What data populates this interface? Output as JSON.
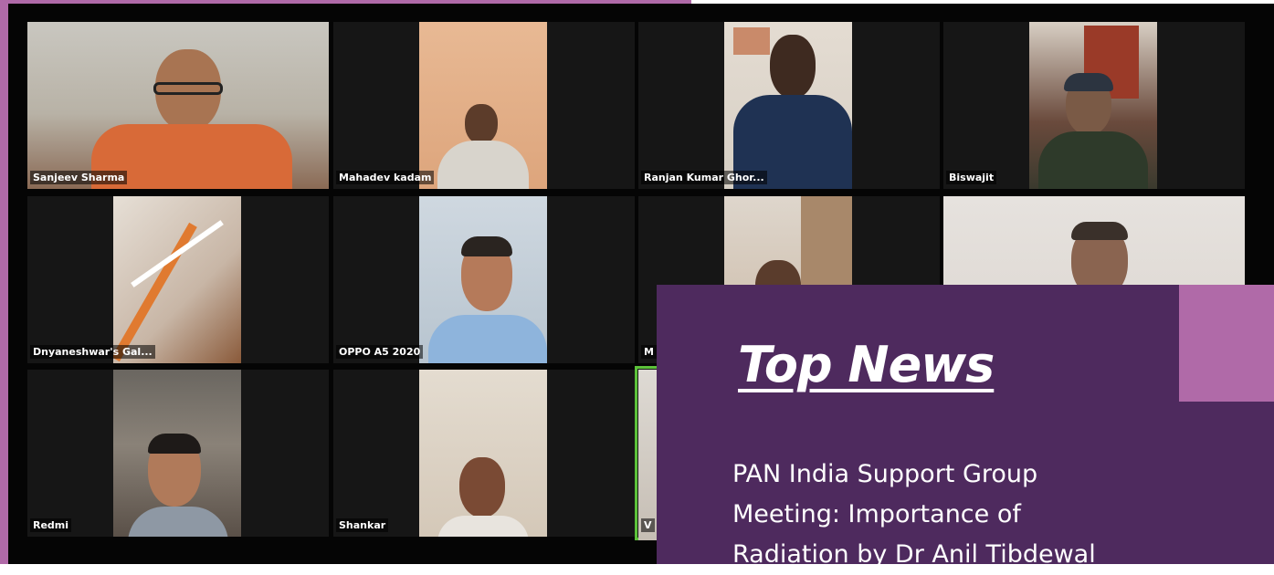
{
  "meeting": {
    "participants": [
      {
        "name": "Sanjeev Sharma",
        "active": false
      },
      {
        "name": "Mahadev kadam",
        "active": false
      },
      {
        "name": "Ranjan Kumar Ghor...",
        "active": false
      },
      {
        "name": "Biswajit",
        "active": false
      },
      {
        "name": "Dnyaneshwar's Gal...",
        "active": false
      },
      {
        "name": "OPPO A5 2020",
        "active": false
      },
      {
        "name": "M",
        "active": false
      },
      {
        "name": "",
        "active": false
      },
      {
        "name": "Redmi",
        "active": false
      },
      {
        "name": "Shankar",
        "active": false
      },
      {
        "name": "V",
        "active": true
      }
    ]
  },
  "news_card": {
    "title": "Top News",
    "lines": [
      "PAN India Support Group",
      "Meeting: Importance of",
      "Radiation by Dr Anil Tibdewal"
    ]
  },
  "colors": {
    "frame": "#b06aa8",
    "card": "#4e2a5e",
    "active_speaker": "#5cc23a"
  }
}
